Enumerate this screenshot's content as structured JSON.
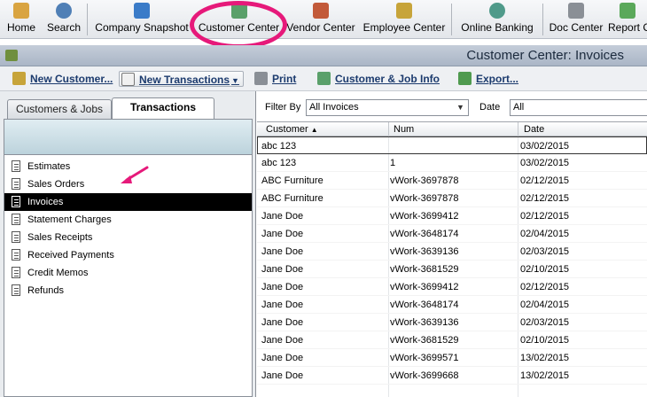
{
  "iconbar": {
    "items": [
      {
        "label": "Home",
        "icon": "home-icon",
        "color": "#d9a441"
      },
      {
        "label": "Search",
        "icon": "search-icon",
        "color": "#4f7fb6"
      },
      {
        "label": "Company Snapshot",
        "icon": "company-snapshot-icon",
        "color": "#3a7bc8"
      },
      {
        "label": "Customer Center",
        "icon": "customer-center-icon",
        "color": "#5aa06a"
      },
      {
        "label": "Vendor Center",
        "icon": "vendor-center-icon",
        "color": "#c25a3a"
      },
      {
        "label": "Employee Center",
        "icon": "employee-center-icon",
        "color": "#c7a43a"
      },
      {
        "label": "Online Banking",
        "icon": "online-banking-icon",
        "color": "#4f9a8a"
      },
      {
        "label": "Doc Center",
        "icon": "doc-center-icon",
        "color": "#8a8f96"
      },
      {
        "label": "Report C",
        "icon": "report-center-icon",
        "color": "#5aa85a"
      }
    ]
  },
  "window": {
    "title": "Customer Center: Invoices"
  },
  "toolbar": {
    "new_customer": "New Customer...",
    "new_transactions": "New Transactions",
    "print": "Print",
    "customer_job_info": "Customer & Job Info",
    "export": "Export..."
  },
  "tabs": {
    "customers_jobs": "Customers & Jobs",
    "transactions": "Transactions"
  },
  "transactions": [
    "Estimates",
    "Sales Orders",
    "Invoices",
    "Statement Charges",
    "Sales Receipts",
    "Received Payments",
    "Credit Memos",
    "Refunds"
  ],
  "filter": {
    "filter_by_label": "Filter By",
    "filter_by_value": "All Invoices",
    "date_label": "Date",
    "date_value": "All"
  },
  "grid": {
    "headers": {
      "customer": "Customer",
      "num": "Num",
      "date": "Date"
    },
    "rows": [
      {
        "customer": "abc 123",
        "num": "",
        "date": "03/02/2015"
      },
      {
        "customer": "abc 123",
        "num": "1",
        "date": "03/02/2015"
      },
      {
        "customer": "ABC Furniture",
        "num": "vWork-3697878",
        "date": "02/12/2015"
      },
      {
        "customer": "ABC Furniture",
        "num": "vWork-3697878",
        "date": "02/12/2015"
      },
      {
        "customer": "Jane Doe",
        "num": "vWork-3699412",
        "date": "02/12/2015"
      },
      {
        "customer": "Jane Doe",
        "num": "vWork-3648174",
        "date": "02/04/2015"
      },
      {
        "customer": "Jane Doe",
        "num": "vWork-3639136",
        "date": "02/03/2015"
      },
      {
        "customer": "Jane Doe",
        "num": "vWork-3681529",
        "date": "02/10/2015"
      },
      {
        "customer": "Jane Doe",
        "num": "vWork-3699412",
        "date": "02/12/2015"
      },
      {
        "customer": "Jane Doe",
        "num": "vWork-3648174",
        "date": "02/04/2015"
      },
      {
        "customer": "Jane Doe",
        "num": "vWork-3639136",
        "date": "02/03/2015"
      },
      {
        "customer": "Jane Doe",
        "num": "vWork-3681529",
        "date": "02/10/2015"
      },
      {
        "customer": "Jane Doe",
        "num": "vWork-3699571",
        "date": "13/02/2015"
      },
      {
        "customer": "Jane Doe",
        "num": "vWork-3699668",
        "date": "13/02/2015"
      }
    ]
  },
  "colors": {
    "highlight_ring": "#e6197a",
    "selected_row": "#000000",
    "link": "#1c3b6e"
  }
}
